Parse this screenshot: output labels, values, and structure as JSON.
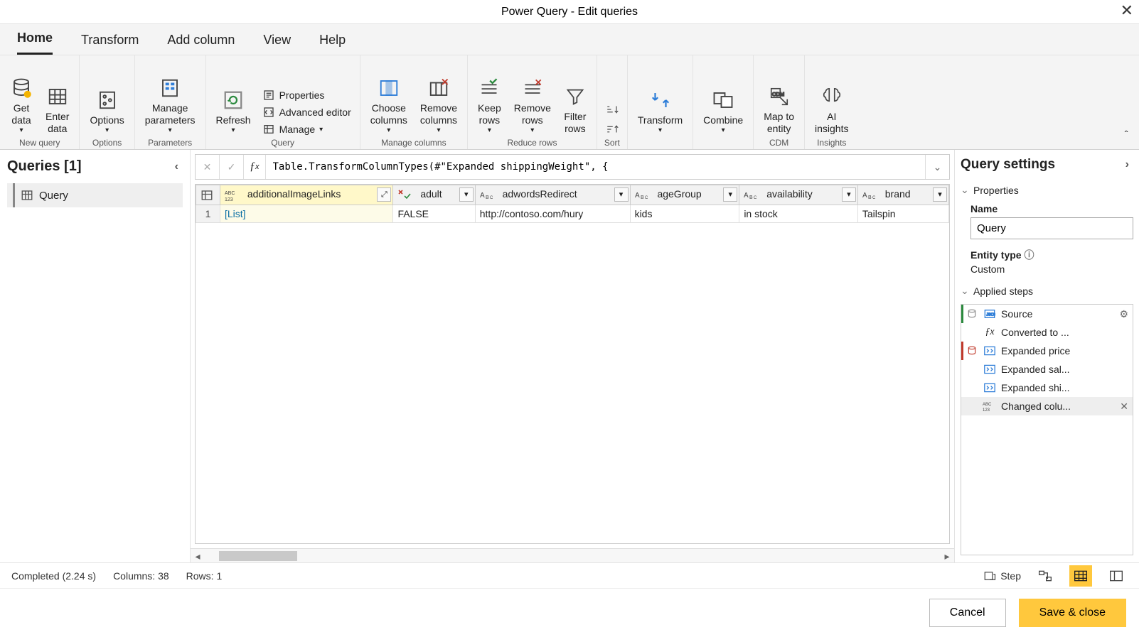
{
  "window": {
    "title": "Power Query - Edit queries"
  },
  "menu_tabs": [
    "Home",
    "Transform",
    "Add column",
    "View",
    "Help"
  ],
  "active_tab": "Home",
  "ribbon": {
    "groups": {
      "new_query": "New query",
      "options": "Options",
      "parameters": "Parameters",
      "query": "Query",
      "manage_columns": "Manage columns",
      "reduce_rows": "Reduce rows",
      "sort": "Sort",
      "cdm": "CDM",
      "insights": "Insights"
    },
    "buttons": {
      "get_data": "Get\ndata",
      "enter_data": "Enter\ndata",
      "options": "Options",
      "manage_parameters": "Manage\nparameters",
      "refresh": "Refresh",
      "properties": "Properties",
      "advanced_editor": "Advanced editor",
      "manage": "Manage",
      "choose_columns": "Choose\ncolumns",
      "remove_columns": "Remove\ncolumns",
      "keep_rows": "Keep\nrows",
      "remove_rows": "Remove\nrows",
      "filter_rows": "Filter\nrows",
      "transform": "Transform",
      "combine": "Combine",
      "map_to_entity": "Map to\nentity",
      "ai_insights": "AI\ninsights"
    }
  },
  "left": {
    "header": "Queries [1]",
    "items": [
      {
        "name": "Query"
      }
    ]
  },
  "formula": "Table.TransformColumnTypes(#\"Expanded shippingWeight\", {",
  "table": {
    "columns": [
      {
        "name": "additionalImageLinks",
        "type": "any",
        "selected": true
      },
      {
        "name": "adult",
        "type": "bool"
      },
      {
        "name": "adwordsRedirect",
        "type": "text"
      },
      {
        "name": "ageGroup",
        "type": "text"
      },
      {
        "name": "availability",
        "type": "text"
      },
      {
        "name": "brand",
        "type": "text"
      }
    ],
    "rows": [
      {
        "n": 1,
        "cells": [
          "[List]",
          "FALSE",
          "http://contoso.com/hury",
          "kids",
          "in stock",
          "Tailspin"
        ]
      }
    ]
  },
  "settings": {
    "header": "Query settings",
    "properties_label": "Properties",
    "name_label": "Name",
    "name_value": "Query",
    "entity_type_label": "Entity type",
    "entity_type_value": "Custom",
    "applied_steps_label": "Applied steps",
    "steps": [
      {
        "label": "Source",
        "gear": true
      },
      {
        "label": "Converted to ..."
      },
      {
        "label": "Expanded price"
      },
      {
        "label": "Expanded sal..."
      },
      {
        "label": "Expanded shi..."
      },
      {
        "label": "Changed colu...",
        "selected": true,
        "deletable": true
      }
    ]
  },
  "status": {
    "completed": "Completed (2.24 s)",
    "columns": "Columns: 38",
    "rows": "Rows: 1",
    "step_btn": "Step"
  },
  "footer": {
    "cancel": "Cancel",
    "save": "Save & close"
  }
}
